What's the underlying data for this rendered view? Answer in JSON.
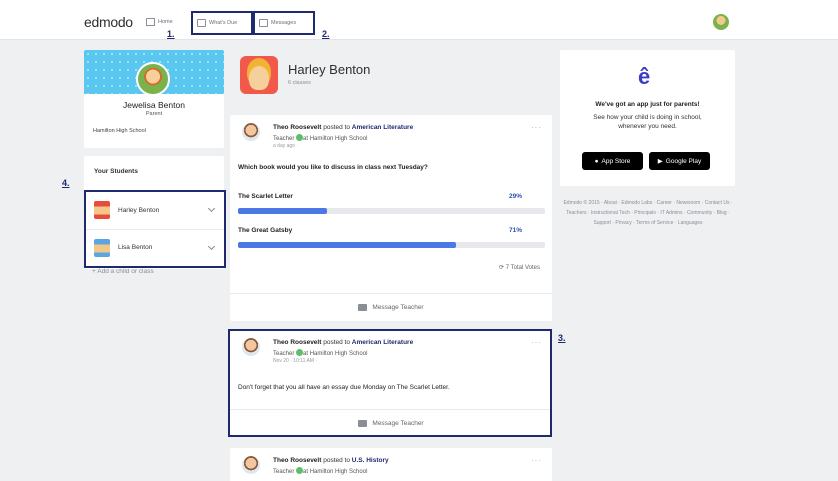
{
  "topbar": {
    "logo": "edmodo",
    "nav": {
      "home": "Home",
      "whats_due": "What's Due",
      "messages": "Messages"
    }
  },
  "annotations": {
    "a1": "1.",
    "a2": "2.",
    "a3": "3.",
    "a4": "4."
  },
  "profile": {
    "name": "Jewelisa Benton",
    "role": "Parent",
    "school": "Hamilton High School"
  },
  "students": {
    "title": "Your Students",
    "items": [
      {
        "name": "Harley Benton"
      },
      {
        "name": "Lisa Benton"
      }
    ],
    "add_label": "+ Add a child or class"
  },
  "main": {
    "name": "Harley Benton",
    "subtitle": "6 classes"
  },
  "posts": [
    {
      "author": "Theo Roosevelt",
      "posted_to": "posted to",
      "class": "American Literature",
      "role": "Teacher",
      "school": "at Hamilton High School",
      "time": "a day ago · ",
      "question": "Which book would you like to discuss in class next Tuesday?",
      "options": [
        {
          "label": "The Scarlet Letter",
          "pct": "29%",
          "value": 0.29
        },
        {
          "label": "The Great Gatsby",
          "pct": "71%",
          "value": 0.71
        }
      ],
      "votes": "7 Total Votes",
      "footer": "Message Teacher"
    },
    {
      "author": "Theo Roosevelt",
      "posted_to": "posted to",
      "class": "American Literature",
      "role": "Teacher",
      "school": "at Hamilton High School",
      "time": "Nov 20 · 10:11 AM · ",
      "body": "Don't forget that you all have an essay due Monday on The Scarlet Letter.",
      "footer": "Message Teacher"
    },
    {
      "author": "Theo Roosevelt",
      "posted_to": "posted to",
      "class": "U.S. History",
      "role": "Teacher",
      "school": "at Hamilton High School"
    }
  ],
  "app": {
    "logo": "ê",
    "title": "We've got an app just for parents!",
    "desc": "See how your child is doing in school, whenever you need.",
    "apple": "App Store",
    "google": "Google Play"
  },
  "footer": "Edmodo © 2015 · About · Edmodo Labs · Career · Newsroom · Contact Us · Teachers · Instructional Tech · Principals · IT Admins · Community · Blog · Support · Privacy · Terms of Service · Languages",
  "colors": {
    "accent": "#1e2a6e",
    "bar": "#4a79e6",
    "bg": "#eef0f2"
  }
}
